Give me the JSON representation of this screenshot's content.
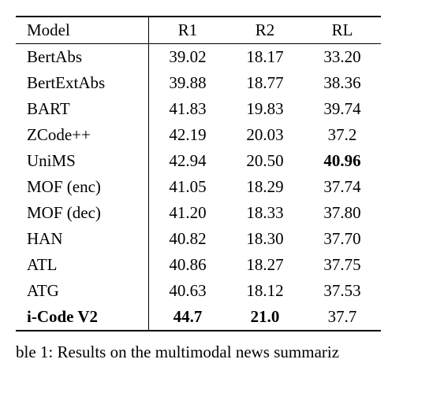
{
  "chart_data": {
    "type": "table",
    "columns": [
      "Model",
      "R1",
      "R2",
      "RL"
    ],
    "rows": [
      {
        "model": "BertAbs",
        "r1": "39.02",
        "r2": "18.17",
        "rl": "33.20",
        "bold_model": false,
        "bold_r1": false,
        "bold_r2": false,
        "bold_rl": false
      },
      {
        "model": "BertExtAbs",
        "r1": "39.88",
        "r2": "18.77",
        "rl": "38.36",
        "bold_model": false,
        "bold_r1": false,
        "bold_r2": false,
        "bold_rl": false
      },
      {
        "model": "BART",
        "r1": "41.83",
        "r2": "19.83",
        "rl": "39.74",
        "bold_model": false,
        "bold_r1": false,
        "bold_r2": false,
        "bold_rl": false
      },
      {
        "model": "ZCode++",
        "r1": "42.19",
        "r2": "20.03",
        "rl": "37.2",
        "bold_model": false,
        "bold_r1": false,
        "bold_r2": false,
        "bold_rl": false
      },
      {
        "model": "UniMS",
        "r1": "42.94",
        "r2": "20.50",
        "rl": "40.96",
        "bold_model": false,
        "bold_r1": false,
        "bold_r2": false,
        "bold_rl": true
      },
      {
        "model": "MOF (enc)",
        "r1": "41.05",
        "r2": "18.29",
        "rl": "37.74",
        "bold_model": false,
        "bold_r1": false,
        "bold_r2": false,
        "bold_rl": false
      },
      {
        "model": "MOF (dec)",
        "r1": "41.20",
        "r2": "18.33",
        "rl": "37.80",
        "bold_model": false,
        "bold_r1": false,
        "bold_r2": false,
        "bold_rl": false
      },
      {
        "model": "HAN",
        "r1": "40.82",
        "r2": "18.30",
        "rl": "37.70",
        "bold_model": false,
        "bold_r1": false,
        "bold_r2": false,
        "bold_rl": false
      },
      {
        "model": "ATL",
        "r1": "40.86",
        "r2": "18.27",
        "rl": "37.75",
        "bold_model": false,
        "bold_r1": false,
        "bold_r2": false,
        "bold_rl": false
      },
      {
        "model": "ATG",
        "r1": "40.63",
        "r2": "18.12",
        "rl": "37.53",
        "bold_model": false,
        "bold_r1": false,
        "bold_r2": false,
        "bold_rl": false
      },
      {
        "model": "i-Code V2",
        "r1": "44.7",
        "r2": "21.0",
        "rl": "37.7",
        "bold_model": true,
        "bold_r1": true,
        "bold_r2": true,
        "bold_rl": false
      }
    ]
  },
  "header": {
    "model": "Model",
    "r1": "R1",
    "r2": "R2",
    "rl": "RL"
  },
  "caption_prefix": "ble 1:",
  "caption_text": "Results on the multimodal news summariz"
}
